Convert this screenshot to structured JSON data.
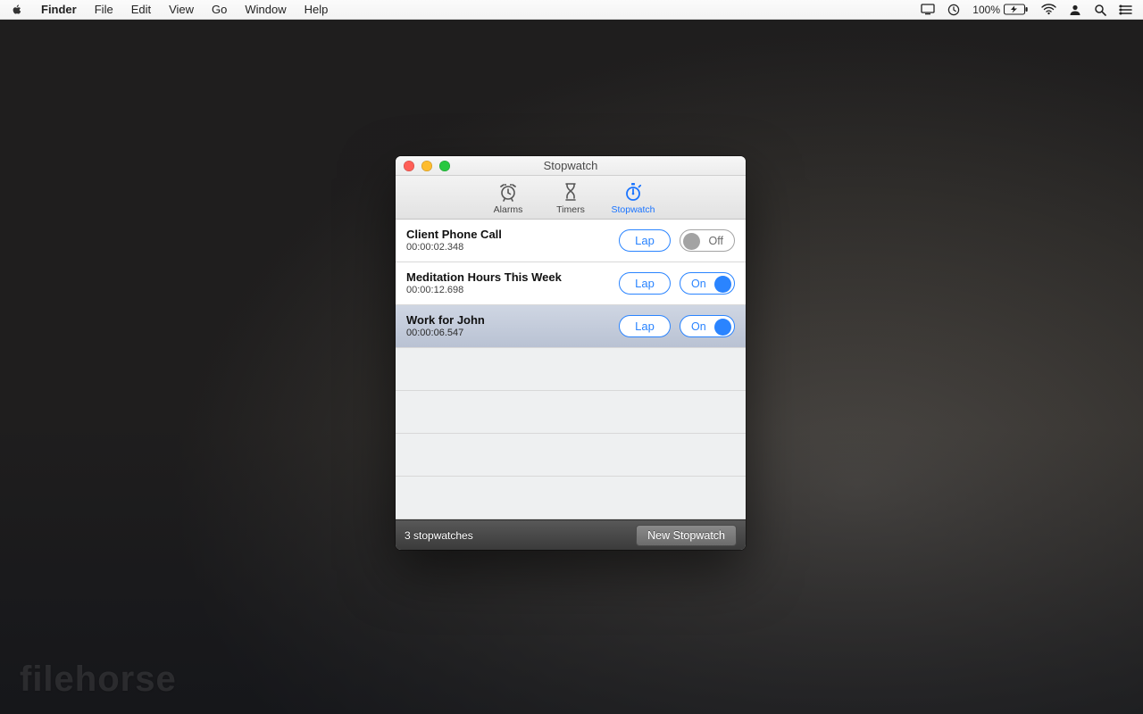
{
  "menubar": {
    "app": "Finder",
    "items": [
      "File",
      "Edit",
      "View",
      "Go",
      "Window",
      "Help"
    ],
    "battery_pct": "100%"
  },
  "window": {
    "title": "Stopwatch",
    "tabs": [
      {
        "label": "Alarms",
        "icon": "alarm-icon",
        "selected": false
      },
      {
        "label": "Timers",
        "icon": "hourglass-icon",
        "selected": false
      },
      {
        "label": "Stopwatch",
        "icon": "stopwatch-icon",
        "selected": true
      }
    ],
    "rows": [
      {
        "name": "Client Phone Call",
        "time": "00:00:02.348",
        "lap": "Lap",
        "state": "Off",
        "on": false,
        "selected": false
      },
      {
        "name": "Meditation Hours This Week",
        "time": "00:00:12.698",
        "lap": "Lap",
        "state": "On",
        "on": true,
        "selected": false
      },
      {
        "name": "Work for John",
        "time": "00:00:06.547",
        "lap": "Lap",
        "state": "On",
        "on": true,
        "selected": true
      }
    ],
    "footer": {
      "count": "3 stopwatches",
      "new_btn": "New Stopwatch"
    }
  },
  "watermark": "filehorse"
}
